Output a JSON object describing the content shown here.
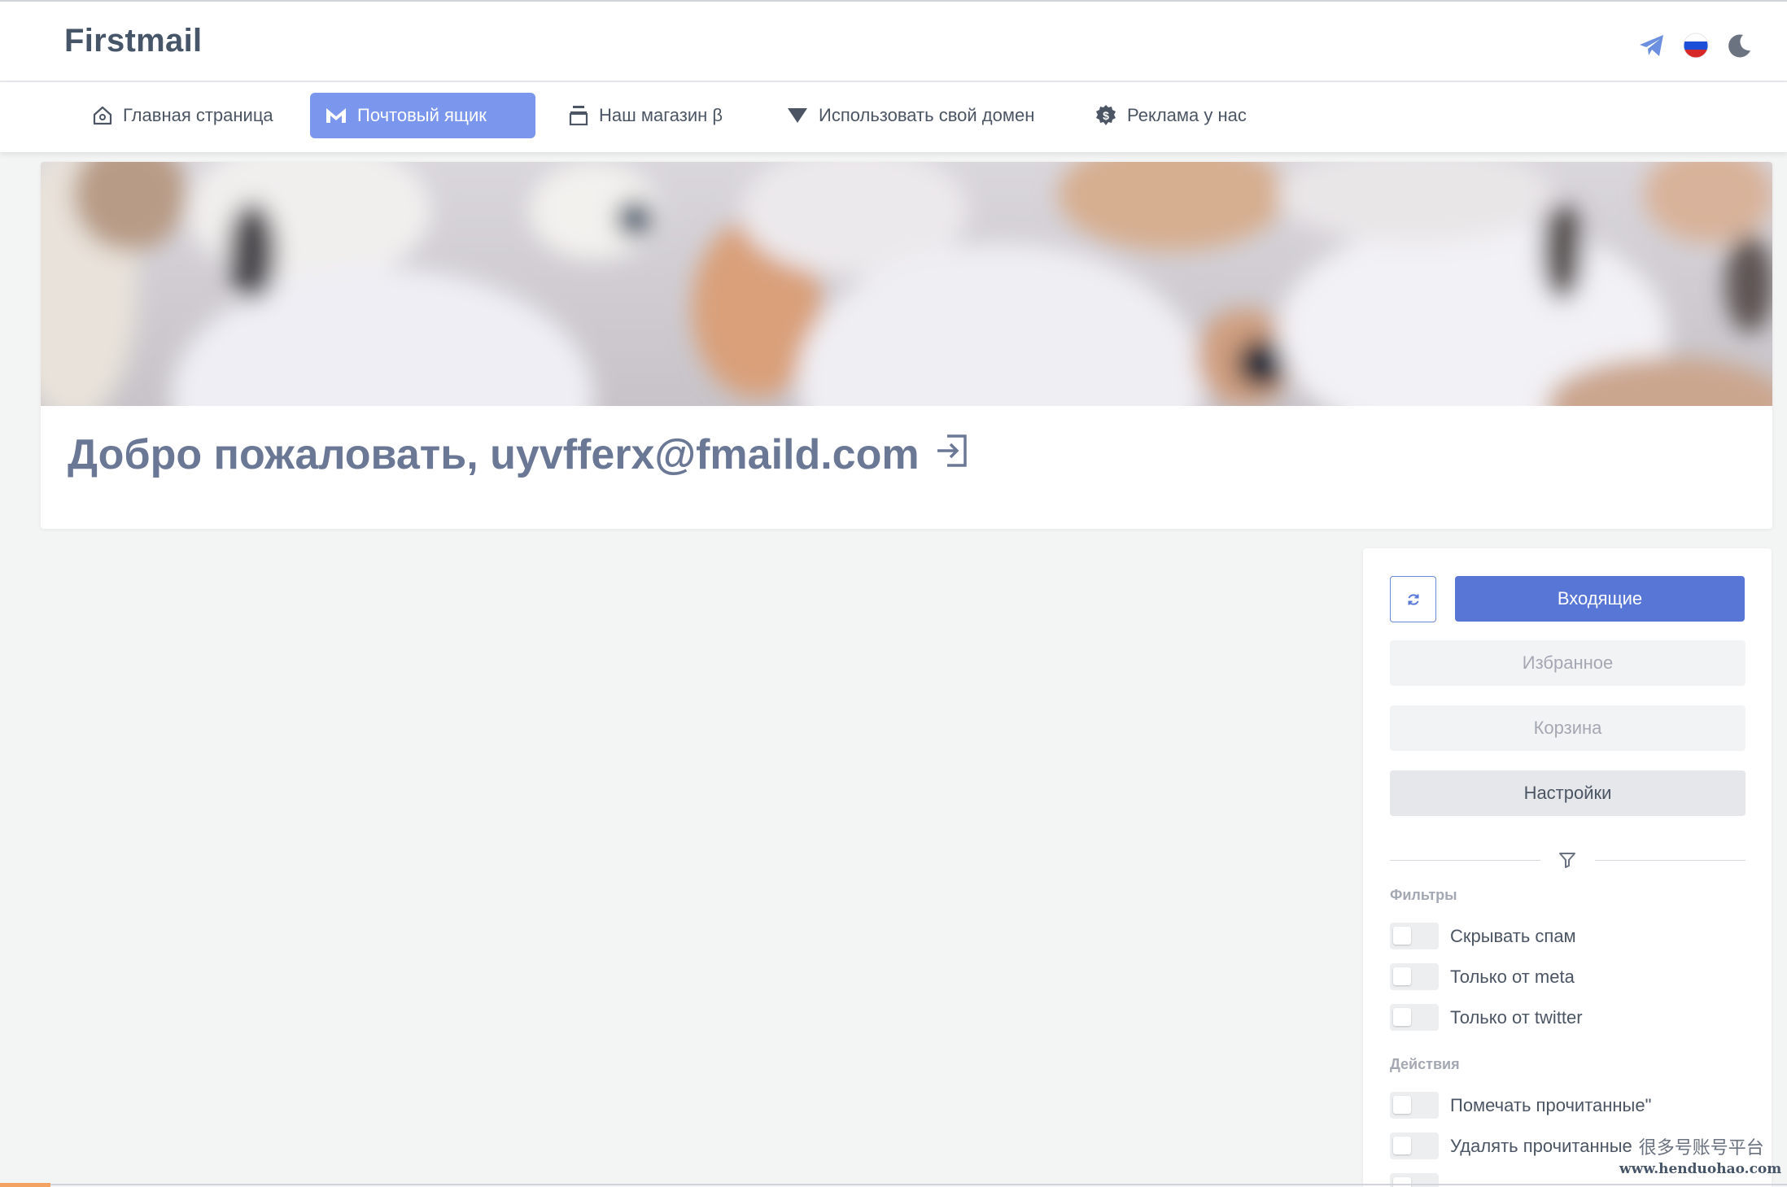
{
  "header": {
    "brand": "Firstmail",
    "icons": [
      "telegram-icon",
      "russia-flag-icon",
      "moon-icon"
    ]
  },
  "nav": {
    "items": [
      {
        "label": "Главная страница",
        "icon": "home-icon",
        "active": false
      },
      {
        "label": "Почтовый ящик",
        "icon": "gmail-m-icon",
        "active": true
      },
      {
        "label": "Наш магазин β",
        "icon": "shop-icon",
        "active": false
      },
      {
        "label": "Использовать свой домен",
        "icon": "triangle-down-icon",
        "active": false
      },
      {
        "label": "Реклама у нас",
        "icon": "dollar-badge-icon",
        "active": false
      }
    ]
  },
  "welcome": {
    "text": "Добро пожаловать, uyvfferx@fmaild.com",
    "icon": "logout-icon"
  },
  "panel": {
    "inbox_label": "Входящие",
    "favorites_label": "Избранное",
    "trash_label": "Корзина",
    "settings_label": "Настройки",
    "filters_title": "Фильтры",
    "filters": [
      {
        "label": "Скрывать спам",
        "on": false
      },
      {
        "label": "Только от meta",
        "on": false
      },
      {
        "label": "Только от twitter",
        "on": false
      }
    ],
    "actions_title": "Действия",
    "actions": [
      {
        "label": "Помечать прочитанные\"",
        "on": false
      },
      {
        "label": "Удалять прочитанные",
        "on": false
      }
    ]
  },
  "watermark": {
    "cn": "很多号账号平台",
    "url": "www.henduohao.com"
  },
  "colors": {
    "accent": "#7b96ed",
    "primary_button": "#5876d6",
    "brand_text": "#475569",
    "welcome_text": "#6b7895"
  }
}
